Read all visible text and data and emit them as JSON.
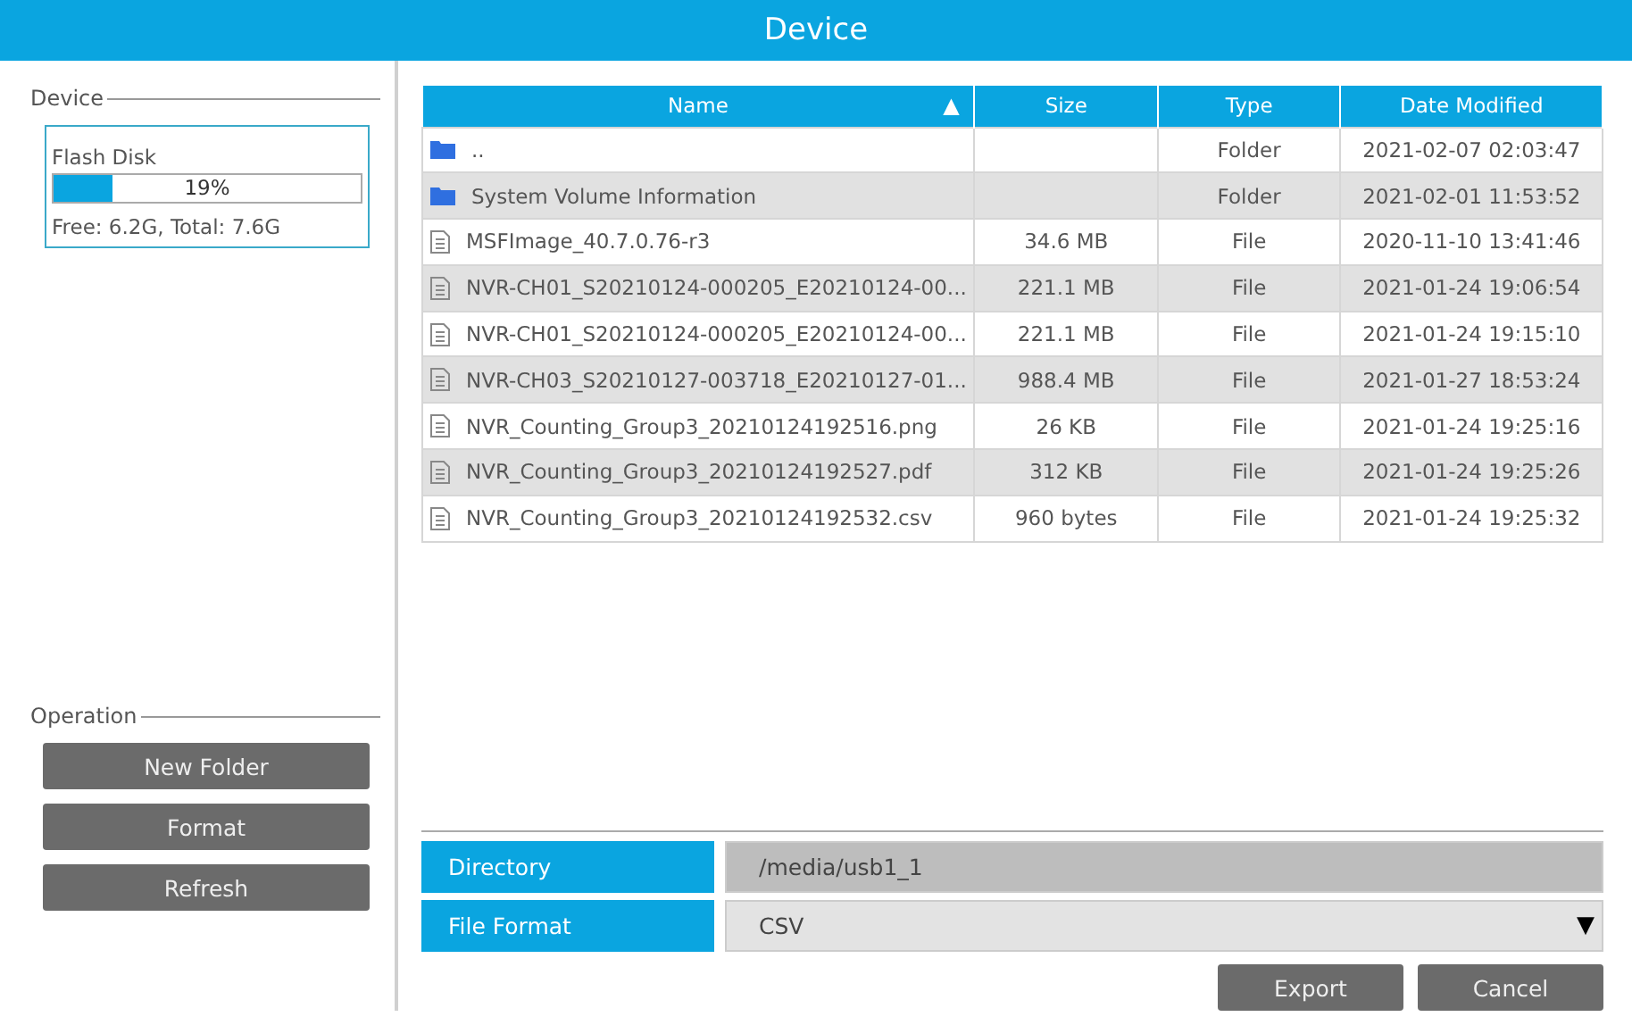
{
  "window": {
    "title": "Device"
  },
  "device_section": {
    "label": "Device",
    "disk": {
      "name": "Flash Disk",
      "level": 0.19,
      "percent": "19%",
      "info": "Free: 6.2G, Total: 7.6G"
    }
  },
  "operation_section": {
    "label": "Operation",
    "buttons": [
      "New Folder",
      "Format",
      "Refresh"
    ]
  },
  "table": {
    "columns": [
      {
        "label": "Name",
        "sort": "▲"
      },
      {
        "label": "Size"
      },
      {
        "label": "Type"
      },
      {
        "label": "Date Modified"
      }
    ],
    "rows": [
      {
        "kind": "folder",
        "name": "..",
        "size": "",
        "type": "Folder",
        "date": "2021-02-07 02:03:47"
      },
      {
        "kind": "folder",
        "name": "System Volume Information",
        "size": "",
        "type": "Folder",
        "date": "2021-02-01 11:53:52"
      },
      {
        "kind": "file",
        "name": "MSFImage_40.7.0.76-r3",
        "size": "34.6 MB",
        "type": "File",
        "date": "2020-11-10 13:41:46"
      },
      {
        "kind": "file",
        "name": "NVR-CH01_S20210124-000205_E20210124-00...",
        "size": "221.1 MB",
        "type": "File",
        "date": "2021-01-24 19:06:54"
      },
      {
        "kind": "file",
        "name": "NVR-CH01_S20210124-000205_E20210124-00...",
        "size": "221.1 MB",
        "type": "File",
        "date": "2021-01-24 19:15:10"
      },
      {
        "kind": "file",
        "name": "NVR-CH03_S20210127-003718_E20210127-01...",
        "size": "988.4 MB",
        "type": "File",
        "date": "2021-01-27 18:53:24"
      },
      {
        "kind": "file",
        "name": "NVR_Counting_Group3_20210124192516.png",
        "size": "26 KB",
        "type": "File",
        "date": "2021-01-24 19:25:16"
      },
      {
        "kind": "file",
        "name": "NVR_Counting_Group3_20210124192527.pdf",
        "size": "312 KB",
        "type": "File",
        "date": "2021-01-24 19:25:26"
      },
      {
        "kind": "file",
        "name": "NVR_Counting_Group3_20210124192532.csv",
        "size": "960 bytes",
        "type": "File",
        "date": "2021-01-24 19:25:32"
      }
    ]
  },
  "export": {
    "directory": {
      "label": "Directory",
      "value": "/media/usb1_1"
    },
    "file_format": {
      "label": "File Format",
      "value": "CSV",
      "arrow": "▼"
    },
    "buttons": [
      "Export",
      "Cancel"
    ]
  }
}
